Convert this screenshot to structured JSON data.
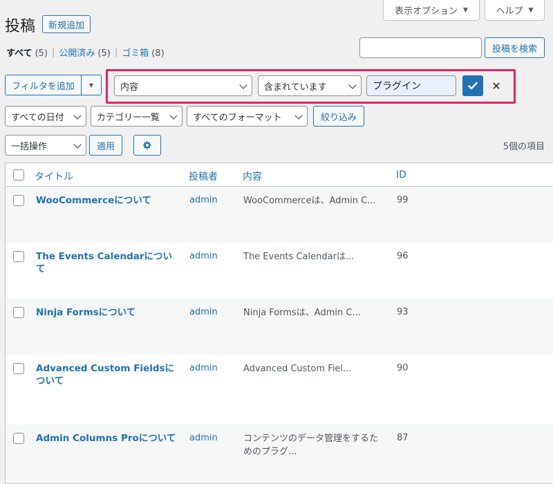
{
  "screen_meta": {
    "options_label": "表示オプション",
    "help_label": "ヘルプ"
  },
  "header": {
    "title": "投稿",
    "add_new_label": "新規追加"
  },
  "views": [
    {
      "label": "すべて",
      "count": "(5)"
    },
    {
      "label": "公開済み",
      "count": "(5)"
    },
    {
      "label": "ゴミ箱",
      "count": "(8)"
    }
  ],
  "search": {
    "value": "",
    "button_label": "投稿を検索"
  },
  "filter": {
    "add_label": "フィルタを追加",
    "field_selected": "内容",
    "operator_selected": "含まれています",
    "value": "プラグイン"
  },
  "filters_row": {
    "date_selected": "すべての日付",
    "category_selected": "カテゴリー一覧",
    "format_selected": "すべてのフォーマット",
    "filter_button": "絞り込み"
  },
  "bulk": {
    "action_selected": "一括操作",
    "apply_label": "適用"
  },
  "items_count": "5個の項目",
  "table": {
    "columns": {
      "title": "タイトル",
      "author": "投稿者",
      "content": "内容",
      "id": "ID"
    },
    "rows": [
      {
        "title": "WooCommerceについて",
        "author": "admin",
        "content": "WooCommerceは、Admin C...",
        "id": "99"
      },
      {
        "title": "The Events Calendarについて",
        "author": "admin",
        "content": "The Events Calendarは...",
        "id": "96"
      },
      {
        "title": "Ninja Formsについて",
        "author": "admin",
        "content": "Ninja Formsは、Admin C...",
        "id": "93"
      },
      {
        "title": "Advanced Custom Fieldsについて",
        "author": "admin",
        "content": "Advanced Custom Fiel...",
        "id": "90"
      },
      {
        "title": "Admin Columns Proについて",
        "author": "admin",
        "content": "コンテンツのデータ管理をするためのプラグ...",
        "id": "87"
      }
    ]
  }
}
